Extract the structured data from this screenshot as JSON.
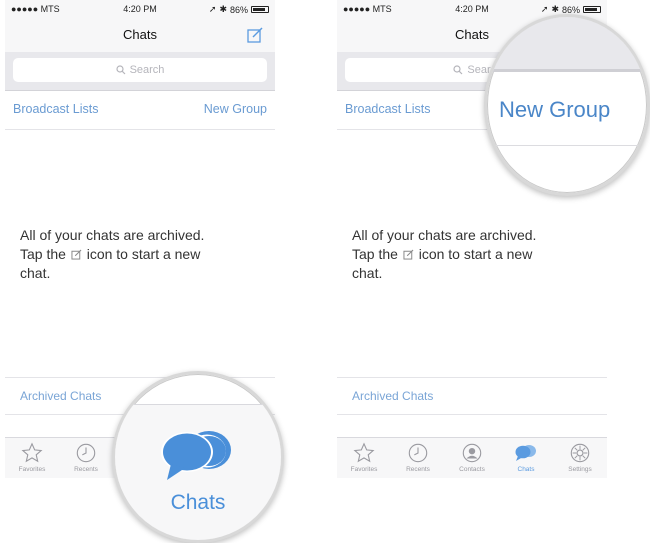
{
  "status": {
    "carrier": "●●●●● MTS",
    "time": "4:20 PM",
    "battery": "86%"
  },
  "nav": {
    "title": "Chats"
  },
  "search": {
    "placeholder": "Search",
    "magnified_placeholder": "Sear"
  },
  "lists": {
    "broadcast": "Broadcast Lists",
    "new_group": "New Group"
  },
  "empty": {
    "line1": "All of your chats are archived.",
    "line2_before": "Tap the",
    "line2_after": "icon to start a new",
    "line3": "chat."
  },
  "archived": {
    "label": "Archived Chats"
  },
  "tabs": [
    {
      "label": "Favorites",
      "icon": "star-icon"
    },
    {
      "label": "Recents",
      "icon": "clock-icon"
    },
    {
      "label": "Contacts",
      "icon": "contact-icon"
    },
    {
      "label": "Chats",
      "icon": "chat-bubbles-icon",
      "active": true
    },
    {
      "label": "Settings",
      "icon": "gear-icon"
    }
  ],
  "magnified": {
    "chats_label": "Chats",
    "new_group_label": "New Group"
  },
  "colors": {
    "accent": "#4a8fd9",
    "link": "#6a9bd2",
    "tab_inactive": "#9a9aa0"
  }
}
